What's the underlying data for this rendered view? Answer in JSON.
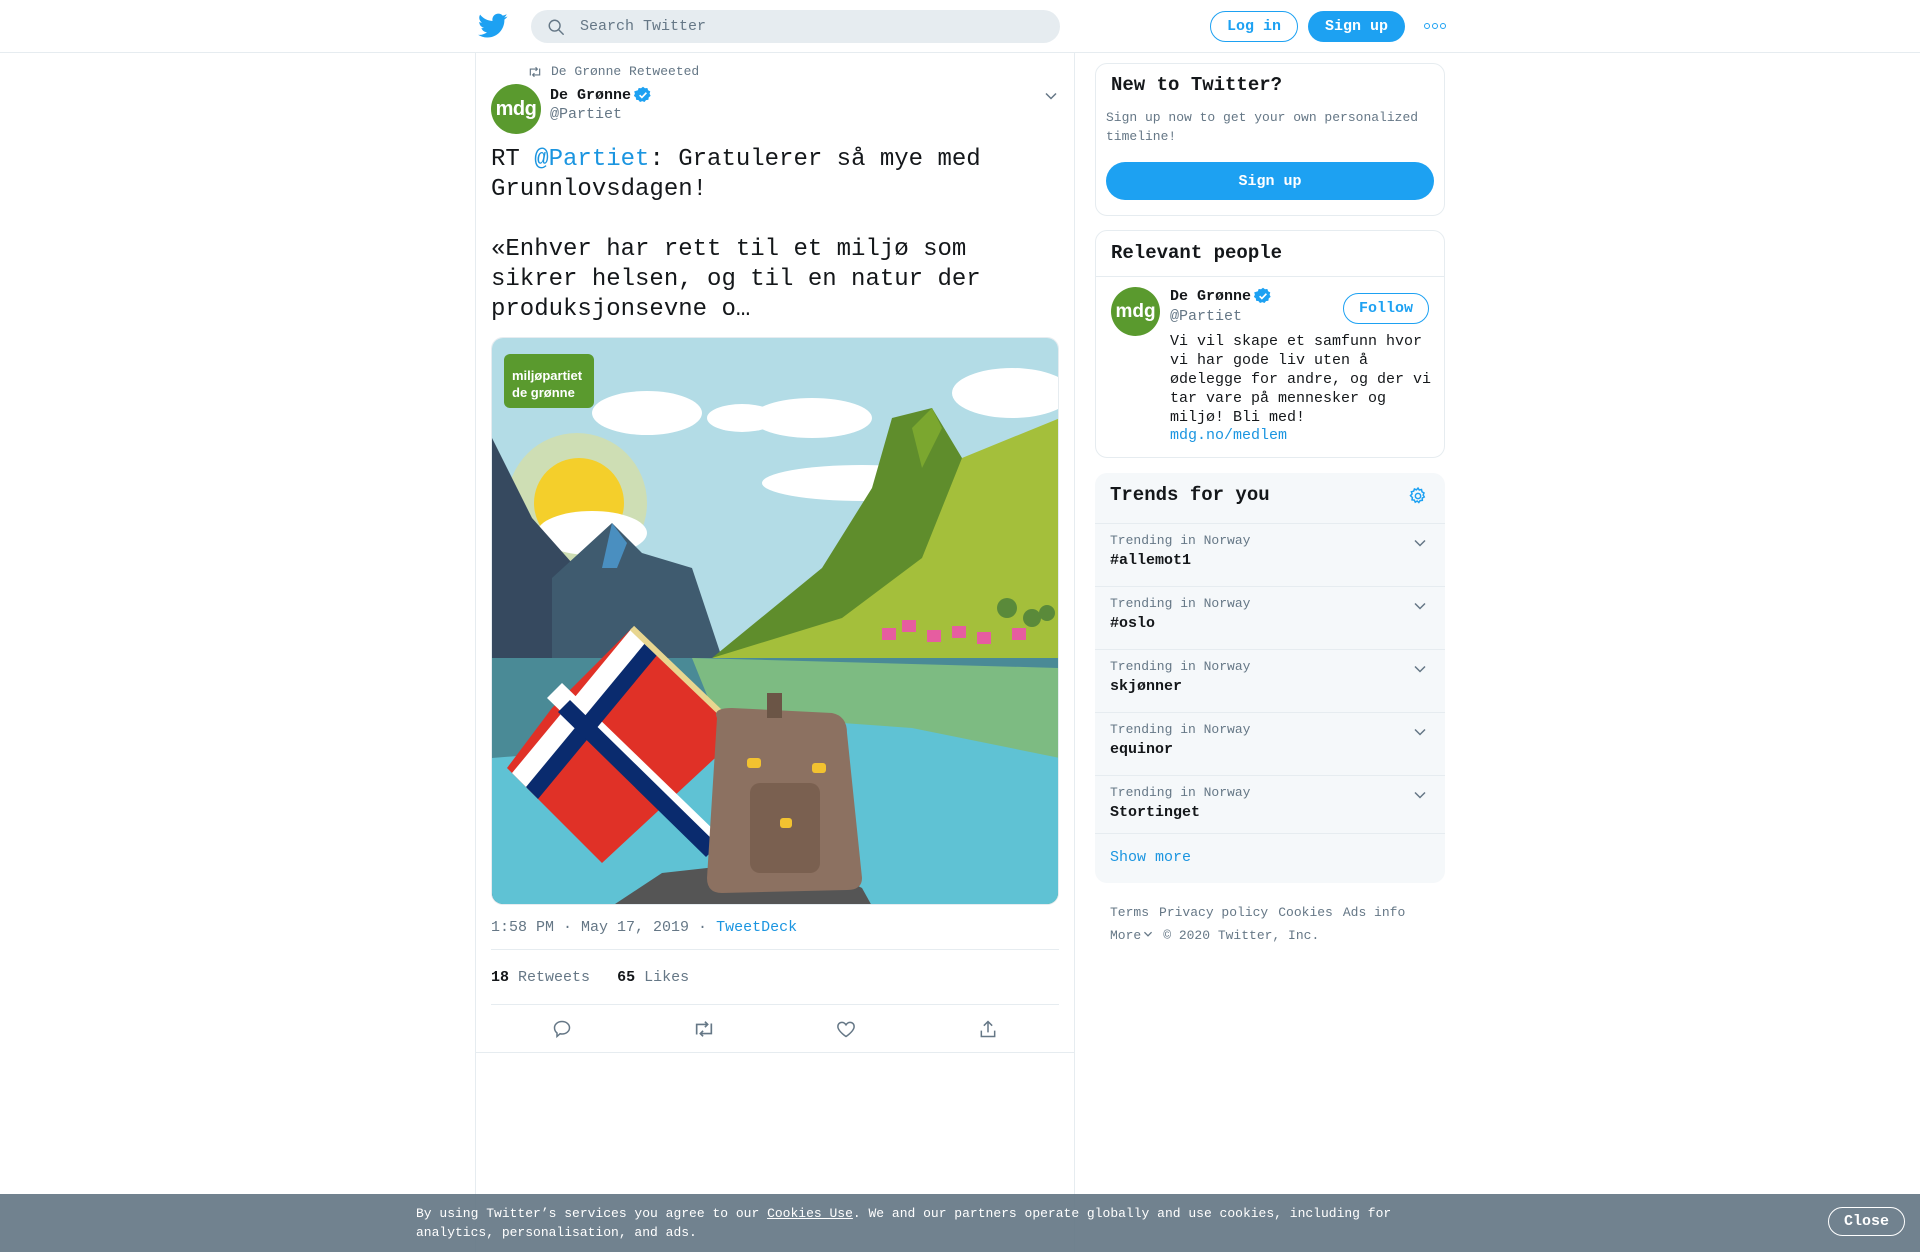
{
  "topbar": {
    "search_placeholder": "Search Twitter",
    "login_label": "Log in",
    "signup_label": "Sign up"
  },
  "tweet": {
    "retweeted_by": "De Grønne Retweeted",
    "author_name": "De Grønne",
    "author_handle": "@Partiet",
    "avatar_text": "mdg",
    "text_prefix": "RT ",
    "mention": "@Partiet",
    "text_rest": ": Gratulerer så mye med Grunnlovsdagen!\n\n«Enhver har rett til et miljø som sikrer helsen, og til en natur der produksjonsevne o…",
    "media_logo_line1": "miljøpartiet",
    "media_logo_line2": "de grønne",
    "timestamp": "1:58 PM · May 17, 2019",
    "separator": " · ",
    "source": "TweetDeck",
    "retweets_count": "18",
    "retweets_label": "Retweets",
    "likes_count": "65",
    "likes_label": "Likes"
  },
  "new_to_twitter": {
    "title": "New to Twitter?",
    "description": "Sign up now to get your own personalized timeline!",
    "button": "Sign up"
  },
  "relevant_people": {
    "title": "Relevant people",
    "name": "De Grønne",
    "handle": "@Partiet",
    "avatar_text": "mdg",
    "follow_label": "Follow",
    "bio": "Vi vil skape et samfunn hvor vi har gode liv uten å ødelegge for andre, og der vi tar vare på mennesker og miljø! Bli med!",
    "bio_link": "mdg.no/medlem"
  },
  "trends": {
    "title": "Trends for you",
    "items": [
      {
        "context": "Trending in Norway",
        "name": "#allemot1"
      },
      {
        "context": "Trending in Norway",
        "name": "#oslo"
      },
      {
        "context": "Trending in Norway",
        "name": "skjønner"
      },
      {
        "context": "Trending in Norway",
        "name": "equinor"
      },
      {
        "context": "Trending in Norway",
        "name": "Stortinget"
      }
    ],
    "show_more": "Show more"
  },
  "footer": {
    "terms": "Terms",
    "privacy": "Privacy policy",
    "cookies": "Cookies",
    "ads": "Ads info",
    "more": "More",
    "copyright": "© 2020 Twitter, Inc."
  },
  "cookie_bar": {
    "text_before": "By using Twitter’s services you agree to our ",
    "link": "Cookies Use",
    "text_after": ". We and our partners operate globally and use cookies, including for analytics, personalisation, and ads.",
    "close": "Close"
  },
  "colors": {
    "accent": "#1da1f2",
    "link": "#1b95e0",
    "muted": "#657786",
    "border": "#e6ecf0",
    "avatar_green": "#5a9a2e"
  }
}
